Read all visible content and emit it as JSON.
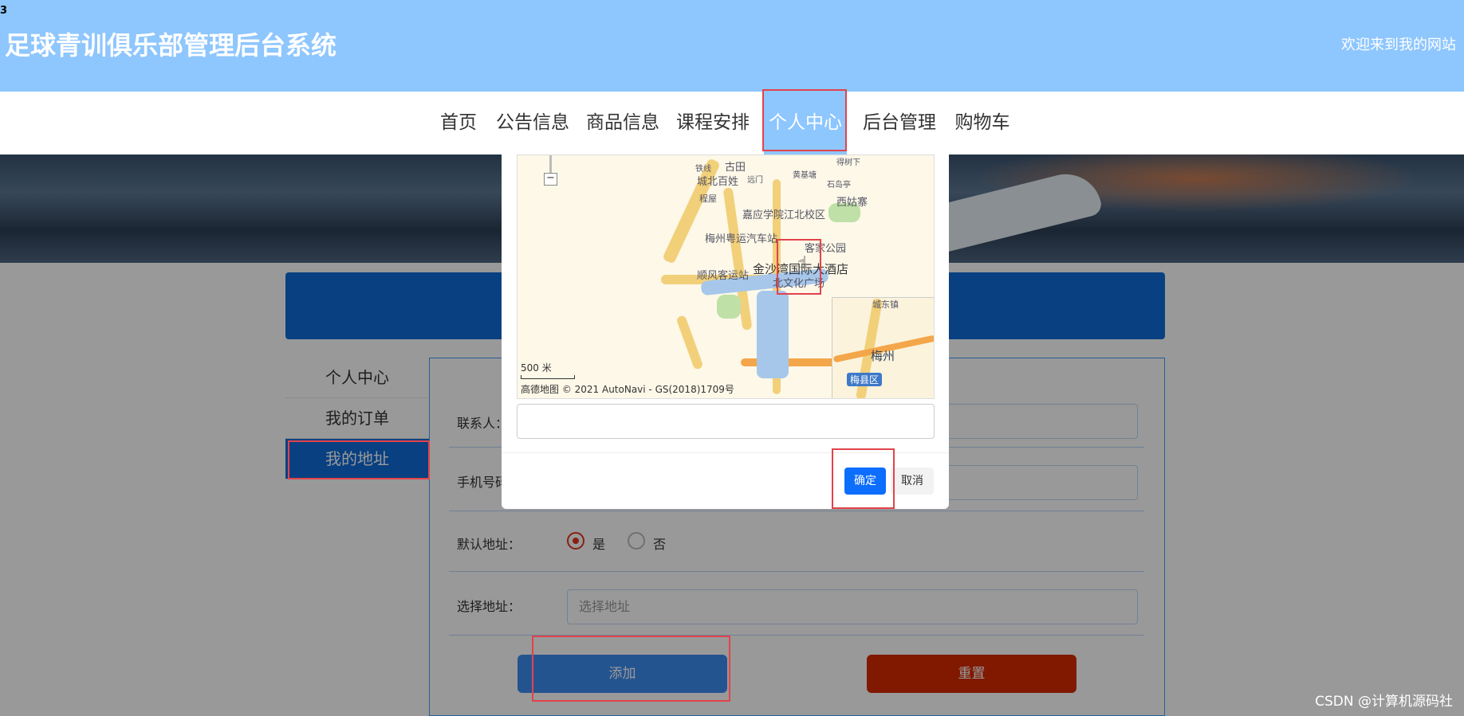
{
  "header": {
    "marker": "3",
    "title": "足球青训俱乐部管理后台系统",
    "welcome": "欢迎来到我的网站"
  },
  "nav": {
    "items": [
      "首页",
      "公告信息",
      "商品信息",
      "课程安排",
      "个人中心",
      "后台管理",
      "购物车"
    ],
    "active_index": 4
  },
  "sidebar": {
    "items": [
      "个人中心",
      "我的订单",
      "我的地址"
    ],
    "active_index": 2
  },
  "form": {
    "contact_label": "联系人：",
    "phone_label": "手机号码",
    "default_label": "默认地址：",
    "default_yes": "是",
    "default_no": "否",
    "default_value": "是",
    "select_label": "选择地址：",
    "select_placeholder": "选择地址",
    "add_button": "添加",
    "reset_button": "重置"
  },
  "map_modal": {
    "map_labels": [
      "古田",
      "城北百姓",
      "梅州粤运汽车站",
      "嘉应学院江北校区",
      "客家公园",
      "金沙湾国际大酒店",
      "顺风客运站",
      "北文化广场",
      "西姑寨",
      "黄基塘",
      "石岛亭",
      "得树下",
      "铁线",
      "远门",
      "程屋",
      "梅州"
    ],
    "minimap_labels": [
      "梅州",
      "梅县区",
      "城东镇"
    ],
    "zoom_out": "−",
    "scale_label": "500 米",
    "copyright": "高德地图 © 2021 AutoNavi - GS(2018)1709号",
    "address_value": "",
    "ok_button": "确定",
    "cancel_button": "取消"
  },
  "watermark": "CSDN @计算机源码社",
  "colors": {
    "header_bg": "#8ec6fe",
    "primary": "#0e6cd7",
    "danger": "#d52b00",
    "highlight": "#e2434b"
  },
  "icons": {
    "cursor": "hand-pointer-icon",
    "logo": "amap-logo-icon"
  }
}
